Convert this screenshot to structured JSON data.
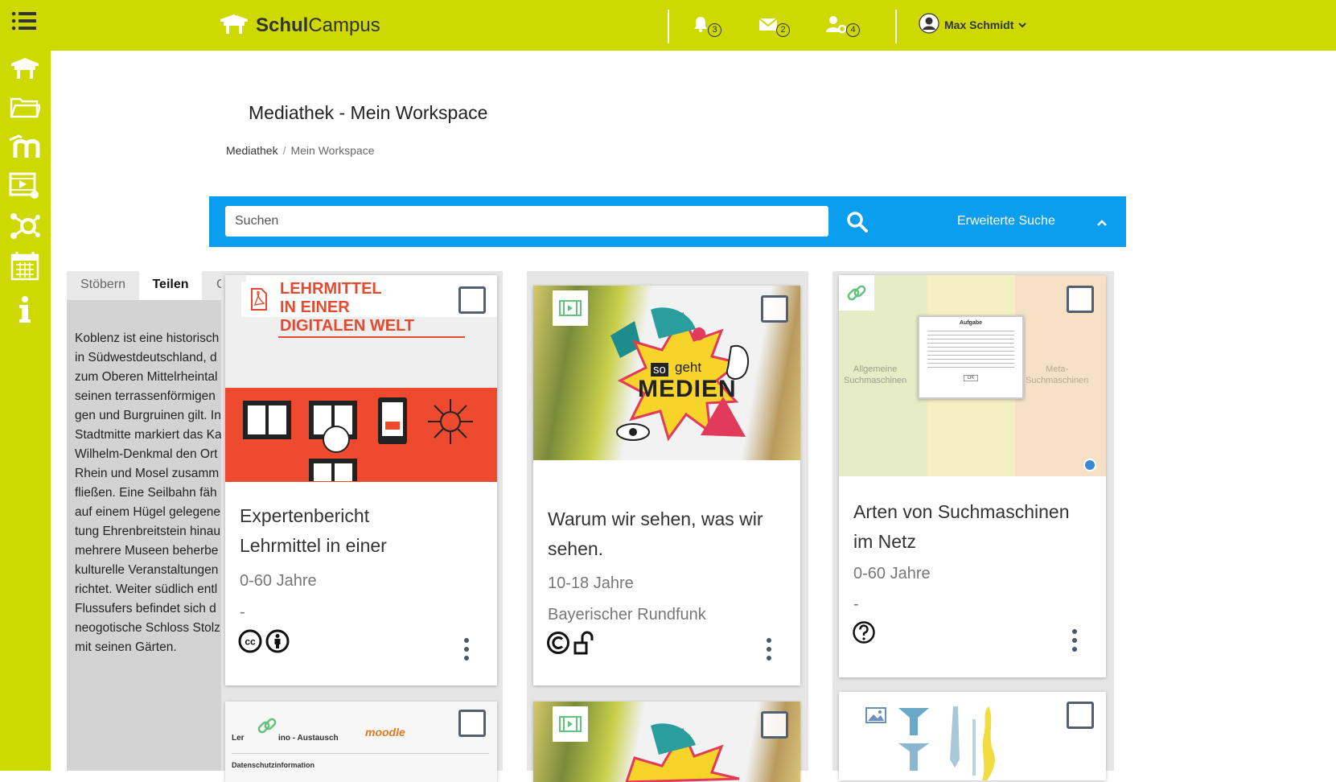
{
  "brand": {
    "name_bold": "Schul",
    "name_rest": "Campus"
  },
  "header": {
    "notifications": {
      "count": "3"
    },
    "messages": {
      "count": "2"
    },
    "contacts": {
      "count": "4"
    },
    "user": {
      "name": "Max Schmidt"
    }
  },
  "colors": {
    "accent": "#cdd900",
    "search_bar": "#0b9dee",
    "checkbox_border": "#546070"
  },
  "sidebar": {
    "items": [
      {
        "icon": "home-icon"
      },
      {
        "icon": "folder-icon"
      },
      {
        "icon": "moodle-icon"
      },
      {
        "icon": "media-icon"
      },
      {
        "icon": "network-icon"
      },
      {
        "icon": "calendar-icon"
      },
      {
        "icon": "info-icon"
      }
    ]
  },
  "page": {
    "title": "Mediathek - Mein Workspace",
    "breadcrumb": {
      "root": "Mediathek",
      "separator": "/",
      "current": "Mein Workspace"
    }
  },
  "search": {
    "placeholder": "Suchen",
    "advanced_label": "Erweiterte Suche"
  },
  "side_panel": {
    "tabs": [
      {
        "label": "Stöbern"
      },
      {
        "label": "Teilen",
        "active": true
      },
      {
        "label": "C"
      }
    ],
    "lines": [
      "Koblenz ist eine historisch",
      "in Südwestdeutschland, d",
      "zum Oberen Mittelrheintal",
      "seinen terrassenförmigen",
      "gen und Burgruinen gilt. In",
      "Stadtmitte markiert das Ka",
      "Wilhelm-Denkmal den Ort",
      "Rhein und Mosel zusamm",
      "fließen. Eine Seilbahn fäh",
      "auf einem Hügel gelegene",
      "tung Ehrenbreitstein hinau",
      "mehrere Museen beherbe",
      "kulturelle Veranstaltungen",
      "richtet. Weiter südlich entl",
      "Flussufers befindet sich d",
      "neogotische Schloss Stolz",
      "mit seinen Gärten."
    ]
  },
  "cards": [
    {
      "type_icon": "pdf-icon",
      "thumb_text": [
        "LEHRMITTEL",
        "IN EINER",
        "DIGITALEN WELT"
      ],
      "title_lines": [
        "Expertenbericht",
        "Lehrmittel in einer"
      ],
      "age": "0-60 Jahre",
      "publisher": "-",
      "license": [
        "cc-icon",
        "by-icon"
      ]
    },
    {
      "type_icon": "video-icon",
      "thumb_text": [
        "so",
        "geht",
        "MEDIEN"
      ],
      "title_lines": [
        "Warum wir sehen, was wir",
        "sehen."
      ],
      "age": "10-18 Jahre",
      "publisher": "Bayerischer Rundfunk",
      "license": [
        "copyright-icon",
        "open-lock-icon"
      ]
    },
    {
      "type_icon": "link-icon",
      "thumb_text": [
        "Allgemeine",
        "Suchmaschinen",
        "Aufgabe",
        "Meta-",
        "Suchmaschinen",
        "OK"
      ],
      "title_lines": [
        "Arten von Suchmaschinen",
        "im Netz"
      ],
      "age": "0-60 Jahre",
      "publisher": "-",
      "license": [
        "unknown-license-icon"
      ]
    },
    {
      "type_icon": "link-icon",
      "thumb_text": [
        "Ler",
        "ino - Austausch",
        "moodle",
        "Datenschutzinformation"
      ]
    },
    {
      "type_icon": "video-icon"
    },
    {
      "type_icon": "image-icon"
    }
  ]
}
